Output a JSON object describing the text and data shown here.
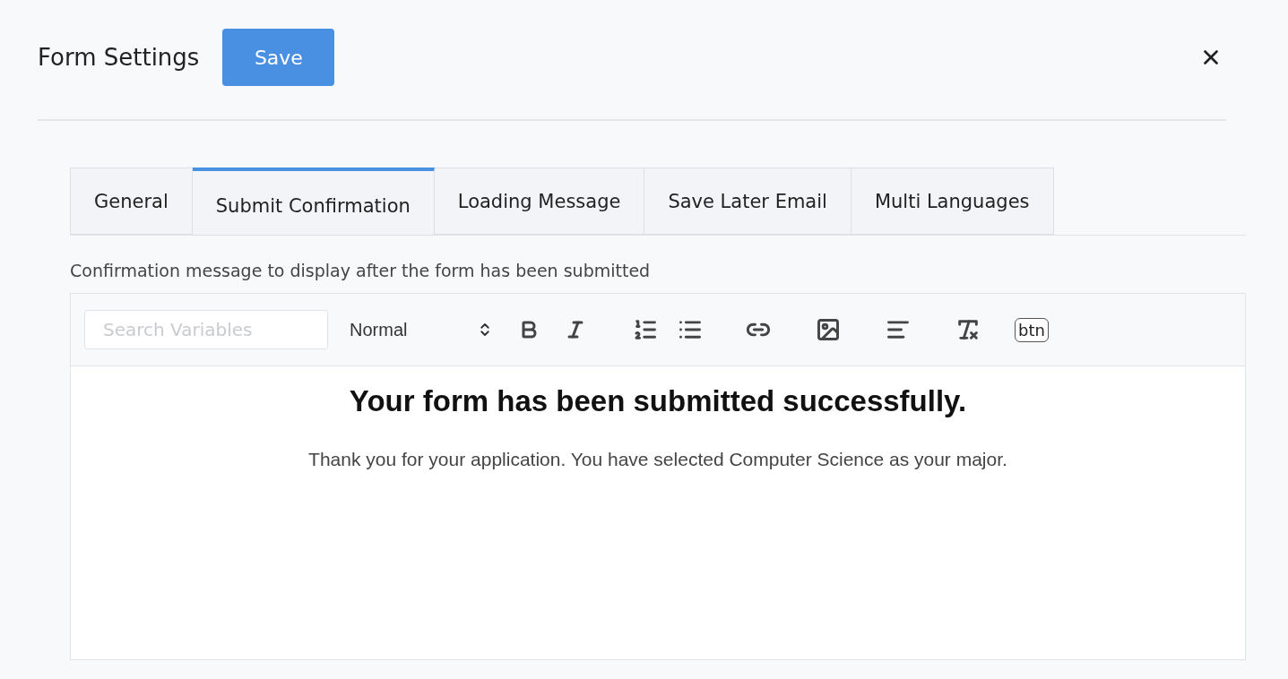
{
  "header": {
    "title": "Form Settings",
    "save_button": "Save"
  },
  "tabs": [
    {
      "label": "General",
      "selected": false
    },
    {
      "label": "Submit Confirmation",
      "selected": true
    },
    {
      "label": "Loading Message",
      "selected": false
    },
    {
      "label": "Save Later Email",
      "selected": false
    },
    {
      "label": "Multi Languages",
      "selected": false
    }
  ],
  "description": "Confirmation message to display after the form has been submitted",
  "editor": {
    "toolbar": {
      "search": {
        "placeholder": "Search Variables"
      },
      "format_select": "Normal",
      "button_tool": "btn"
    },
    "heading": "Your form has been submitted successfully.",
    "body": "Thank you for your application. You have selected Computer Science as your major."
  }
}
